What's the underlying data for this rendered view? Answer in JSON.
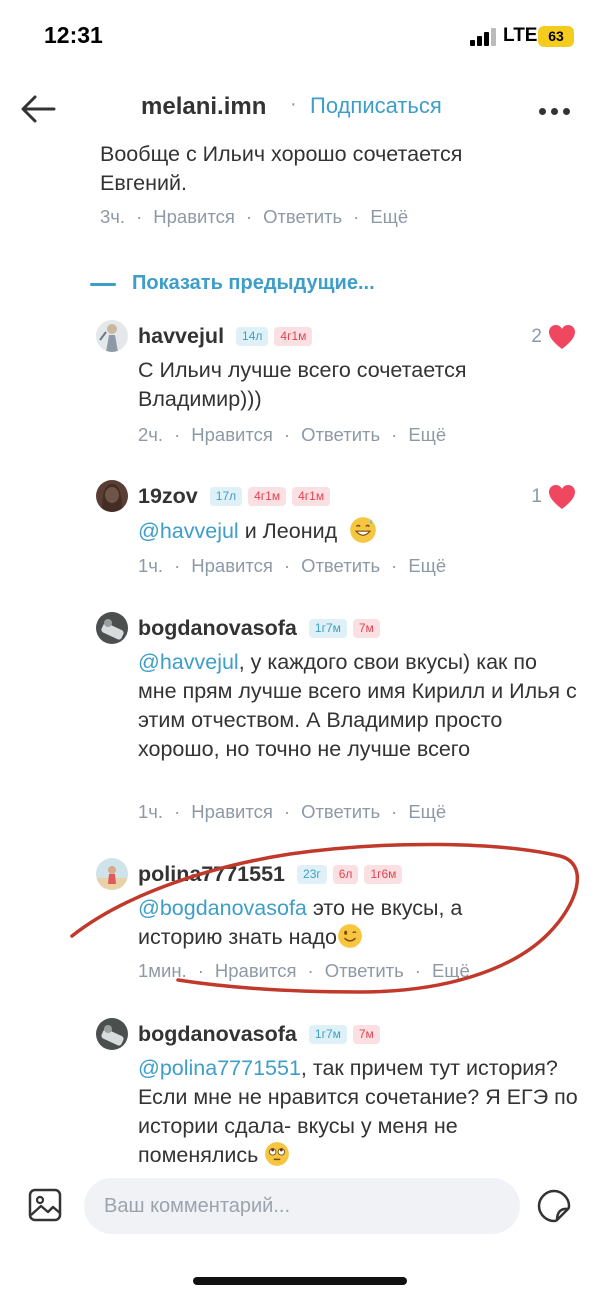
{
  "status": {
    "time": "12:31",
    "network": "LTE",
    "battery": "63"
  },
  "header": {
    "title": "melani.imn",
    "dot": "·",
    "subscribe": "Подписаться"
  },
  "top_comment": {
    "text": "Вообще с Ильич хорошо сочетается Евгений.",
    "time": "3ч.",
    "like": "Нравится",
    "reply": "Ответить",
    "more": "Ещё"
  },
  "show_previous": "Показать предыдущие...",
  "comments": [
    {
      "username": "havvejul",
      "badges": [
        {
          "text": "14л",
          "color": "blue"
        },
        {
          "text": "4г1м",
          "color": "red"
        }
      ],
      "mention": "",
      "text": "С Ильич лучше всего сочетается Владимир)))",
      "time": "2ч.",
      "likes": "2",
      "like": "Нравится",
      "reply": "Ответить",
      "more": "Ещё"
    },
    {
      "username": "19zov",
      "badges": [
        {
          "text": "17л",
          "color": "blue"
        },
        {
          "text": "4г1м",
          "color": "red"
        },
        {
          "text": "4г1м",
          "color": "red"
        }
      ],
      "mention": "@havvejul",
      "text": " и Леонид",
      "emoji": "grinning-sweat-emoji",
      "time": "1ч.",
      "likes": "1",
      "like": "Нравится",
      "reply": "Ответить",
      "more": "Ещё"
    },
    {
      "username": "bogdanovasofa",
      "badges": [
        {
          "text": "1г7м",
          "color": "blue"
        },
        {
          "text": "7м",
          "color": "red"
        }
      ],
      "mention": "@havvejul",
      "text": ", у каждого свои вкусы) как по мне прям лучше всего имя Кирилл и Илья с этим отчеством. А Владимир просто хорошо, но точно не лучше всего",
      "time": "1ч.",
      "like": "Нравится",
      "reply": "Ответить",
      "more": "Ещё"
    },
    {
      "username": "polina7771551",
      "badges": [
        {
          "text": "23г",
          "color": "blue"
        },
        {
          "text": "6л",
          "color": "red"
        },
        {
          "text": "1г6м",
          "color": "red"
        }
      ],
      "mention": "@bogdanovasofa",
      "text": " это не вкусы, а историю знать надо",
      "emoji": "winking-emoji",
      "time": "1мин.",
      "like": "Нравится",
      "reply": "Ответить",
      "more": "Ещё"
    },
    {
      "username": "bogdanovasofa",
      "badges": [
        {
          "text": "1г7м",
          "color": "blue"
        },
        {
          "text": "7м",
          "color": "red"
        }
      ],
      "mention": "@polina7771551",
      "text": ",  так причем тут история? Если мне не нравится сочетание? Я ЕГЭ по истории сдала- вкусы у меня не поменялись",
      "emoji": "eye-roll-emoji"
    }
  ],
  "input": {
    "placeholder": "Ваш комментарий..."
  },
  "colors": {
    "accent": "#3e9ec9",
    "heart": "#ef4760",
    "annotation": "#c0392b",
    "meta": "#8e99a6"
  }
}
